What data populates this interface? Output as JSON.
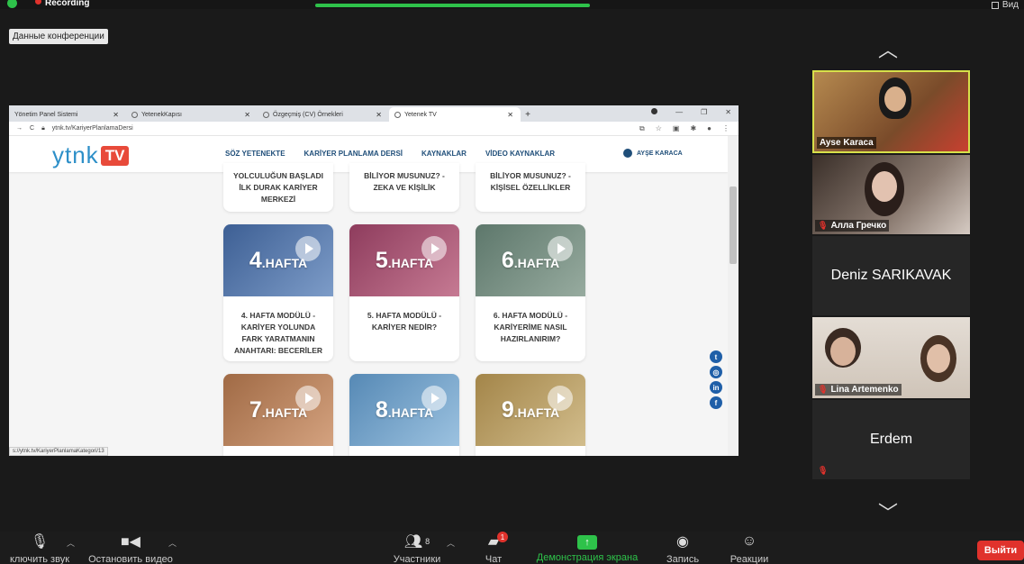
{
  "zoom": {
    "recording_label": "Recording",
    "view_label": "Вид",
    "conference_data_label": "Данные конференции"
  },
  "browser": {
    "tabs": [
      {
        "title": "Yönetim Panel Sistemi"
      },
      {
        "title": "YetenekKapısı"
      },
      {
        "title": "Özgeçmiş (CV) Örnekleri"
      },
      {
        "title": "Yetenek TV"
      }
    ],
    "url": "ytnk.tv/KariyerPlanlamaDersi",
    "status_url": "s://ytnk.tv/KariyerPlanlamaKategori/13"
  },
  "site": {
    "logo_text": "YTNK",
    "logo_tv": "TV",
    "nav": [
      "SÖZ YETENEKTE",
      "KARİYER PLANLAMA DERSİ",
      "KAYNAKLAR",
      "VİDEO KAYNAKLAR"
    ],
    "user": "AYŞE KARACA",
    "top_cards": [
      "YOLCULUĞUN BAŞLADI İLK DURAK KARİYER MERKEZİ",
      "BİLİYOR MUSUNUZ? - ZEKA VE KİŞİLİK",
      "BİLİYOR MUSUNUZ? - KİŞİSEL ÖZELLİKLER"
    ],
    "week_suffix": ".HAFTA",
    "cards": [
      {
        "week": "4",
        "title": "4. HAFTA MODÜLÜ - KARİYER YOLUNDA FARK YARATMANIN ANAHTARI: BECERİLER",
        "color": "#4f6fa3"
      },
      {
        "week": "5",
        "title": "5. HAFTA MODÜLÜ - KARİYER NEDİR?",
        "color": "#9c4b6a"
      },
      {
        "week": "6",
        "title": "6. HAFTA MODÜLÜ - KARİYERİME NASIL HAZIRLANIRIM?",
        "color": "#6b8478"
      },
      {
        "week": "7",
        "title": "",
        "color": "#b5805a"
      },
      {
        "week": "8",
        "title": "",
        "color": "#6a9bc4"
      },
      {
        "week": "9",
        "title": "",
        "color": "#b79a62"
      }
    ],
    "social_icons": [
      "twitter-icon",
      "instagram-icon",
      "linkedin-icon",
      "facebook-icon"
    ]
  },
  "participants": [
    {
      "name": "Ayse Karaca",
      "type": "video",
      "active_speaker": true
    },
    {
      "name": "Алла Гречко",
      "type": "video",
      "muted": true
    },
    {
      "name": "Deniz SARIKAVAK",
      "type": "name"
    },
    {
      "name": "Lina Artemenko",
      "type": "video",
      "muted": true
    },
    {
      "name": "Erdem",
      "type": "name",
      "muted": true
    }
  ],
  "toolbar": {
    "mute_label": "ключить звук",
    "video_label": "Остановить видео",
    "participants_label": "Участники",
    "participants_count": "8",
    "chat_label": "Чат",
    "chat_badge": "1",
    "share_label": "Демонстрация экрана",
    "record_label": "Запись",
    "reactions_label": "Реакции",
    "leave_label": "Выйти"
  }
}
